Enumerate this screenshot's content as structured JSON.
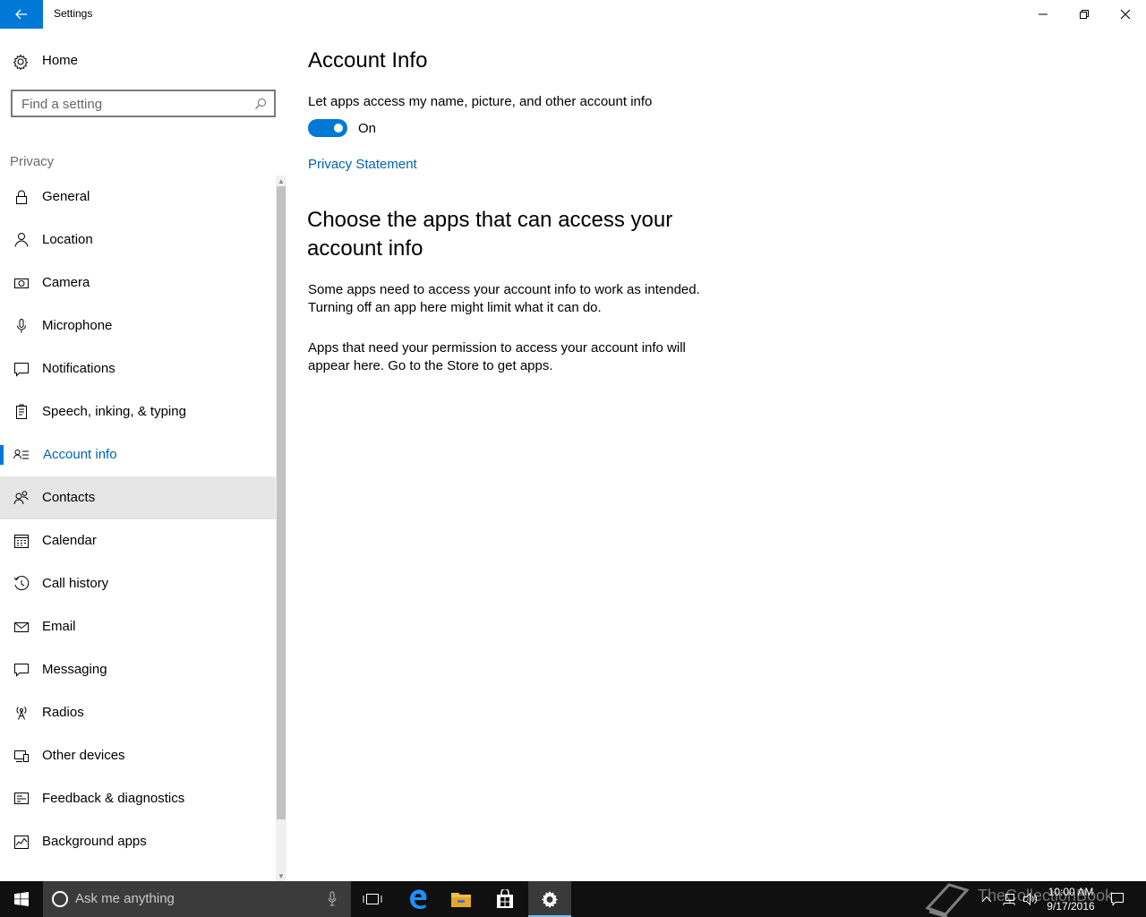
{
  "window": {
    "title": "Settings",
    "controls": {
      "minimize": "minimize",
      "maximize": "restore",
      "close": "close"
    }
  },
  "sidebar": {
    "home_label": "Home",
    "search": {
      "placeholder": "Find a setting"
    },
    "section_label": "Privacy",
    "items": [
      {
        "label": "General",
        "icon": "lock-icon"
      },
      {
        "label": "Location",
        "icon": "location-icon"
      },
      {
        "label": "Camera",
        "icon": "camera-icon"
      },
      {
        "label": "Microphone",
        "icon": "microphone-icon"
      },
      {
        "label": "Notifications",
        "icon": "notifications-icon"
      },
      {
        "label": "Speech, inking, & typing",
        "icon": "speech-icon"
      },
      {
        "label": "Account info",
        "icon": "account-info-icon",
        "selected": true
      },
      {
        "label": "Contacts",
        "icon": "contacts-icon",
        "hovered": true
      },
      {
        "label": "Calendar",
        "icon": "calendar-icon"
      },
      {
        "label": "Call history",
        "icon": "call-history-icon"
      },
      {
        "label": "Email",
        "icon": "email-icon"
      },
      {
        "label": "Messaging",
        "icon": "messaging-icon"
      },
      {
        "label": "Radios",
        "icon": "radios-icon"
      },
      {
        "label": "Other devices",
        "icon": "other-devices-icon"
      },
      {
        "label": "Feedback & diagnostics",
        "icon": "feedback-icon"
      },
      {
        "label": "Background apps",
        "icon": "background-apps-icon"
      }
    ]
  },
  "main": {
    "title": "Account Info",
    "setting_description": "Let apps access my name, picture, and other account info",
    "toggle": {
      "state": "On",
      "on": true
    },
    "privacy_link": "Privacy Statement",
    "section_title": "Choose the apps that can access your account info",
    "paragraph1": "Some apps need to access your account info to work as intended. Turning off an app here might limit what it can do.",
    "paragraph2": "Apps that need your permission to access your account info will appear here. Go to the Store to get apps."
  },
  "taskbar": {
    "search_placeholder": "Ask me anything",
    "clock_time": "10:00 AM",
    "clock_date": "9/17/2016",
    "watermark": "TheCollectionBook"
  },
  "colors": {
    "accent": "#0078d7",
    "link": "#0063b1",
    "taskbar": "#101010"
  }
}
